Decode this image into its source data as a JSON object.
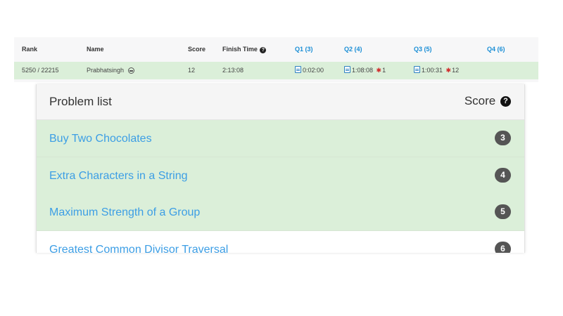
{
  "ranking": {
    "headers": {
      "rank": "Rank",
      "name": "Name",
      "score": "Score",
      "finish_time": "Finish Time",
      "q1": "Q1 (3)",
      "q2": "Q2 (4)",
      "q3": "Q3 (5)",
      "q4": "Q4 (6)"
    },
    "row": {
      "rank": "5250 / 22215",
      "name": "Prabhatsingh",
      "score": "12",
      "finish_time": "2:13:08",
      "q1_time": "0:02:00",
      "q2_time": "1:08:08",
      "q2_wrong": "1",
      "q3_time": "1:00:31",
      "q3_wrong": "12"
    }
  },
  "problem_list": {
    "title": "Problem list",
    "score_label": "Score",
    "problems": [
      {
        "name": "Buy Two Chocolates",
        "score": "3",
        "solved": true
      },
      {
        "name": "Extra Characters in a String",
        "score": "4",
        "solved": true
      },
      {
        "name": "Maximum Strength of a Group",
        "score": "5",
        "solved": true
      },
      {
        "name": "Greatest Common Divisor Traversal",
        "score": "6",
        "solved": false
      }
    ]
  },
  "icons": {
    "help": "question-circle-icon",
    "submission": "file-icon",
    "wrong_answer": "bug-icon",
    "user": "user-avatar-icon"
  },
  "colors": {
    "solved_bg": "#dbefd9",
    "link": "#3c9ee5",
    "question_header": "#1a8ed6",
    "score_badge": "#555555",
    "bug": "#d12b2b"
  }
}
